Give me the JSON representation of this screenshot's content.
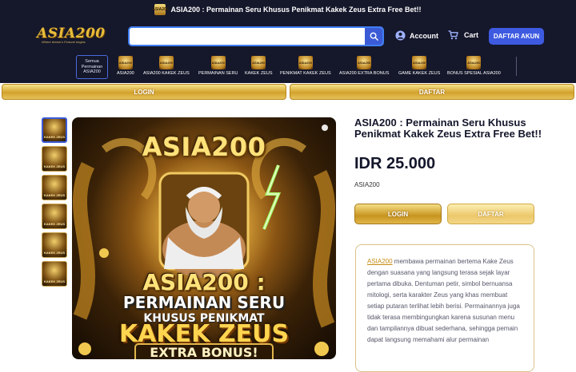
{
  "announcement": {
    "logo_text": "ASIA200",
    "text": "ASIA200 : Permainan Seru Khusus Penikmat Kakek Zeus Extra Free Bet!!"
  },
  "header": {
    "logo": "ASIA200",
    "logo_tagline": "Where dream's Fortune begins",
    "search_placeholder": "",
    "account_label": "Account",
    "cart_label": "Cart",
    "register_label": "DAFTAR AKUN"
  },
  "nav": {
    "all_label": "Semua Permainan ASIA200",
    "icon_text": "ASIA200",
    "items": [
      {
        "label": "ASIA200"
      },
      {
        "label": "ASIA200 KAKEK ZEUS"
      },
      {
        "label": "PERMAINAN SERU"
      },
      {
        "label": "KAKEK ZEUS"
      },
      {
        "label": "PENIKMAT KAKEK ZEUS"
      },
      {
        "label": "ASIA200 EXTRA BONUS"
      },
      {
        "label": "GAME KAKEK ZEUS"
      },
      {
        "label": "BONUS SPESIAL ASIA200"
      }
    ]
  },
  "action_bar": {
    "login_label": "LOGIN",
    "register_label": "DAFTAR"
  },
  "gallery": {
    "thumb_text": "KAKEK ZEUS",
    "thumb_count": 6,
    "hero": {
      "brand": "ASIA200",
      "line1": "ASIA200 :",
      "line2": "PERMAINAN SERU",
      "line3": "KHUSUS PENIKMAT",
      "line4": "KAKEK ZEUS",
      "line5": "EXTRA BONUS!"
    }
  },
  "product": {
    "title": "ASIA200 : Permainan Seru Khusus Penikmat Kakek Zeus Extra Free Bet!!",
    "price": "IDR 25.000",
    "brand": "ASIA200",
    "login_label": "LOGIN",
    "register_label": "DAFTAR",
    "description_link": "ASIA200",
    "description_text": " membawa permainan bertema Kake Zeus dengan suasana yang langsung terasa sejak layar pertama dibuka. Dentuman petir, simbol bernuansa mitologi, serta karakter Zeus yang khas membuat setiap putaran terlihat lebih berisi. Permainannya juga tidak terasa membingungkan karena susunan menu dan tampilannya dibuat sederhana, sehingga pemain dapat langsung memahami alur permainan"
  },
  "colors": {
    "dark_bg": "#15172b",
    "accent_blue": "#3d5ae0",
    "gold": "#d3a22d"
  }
}
